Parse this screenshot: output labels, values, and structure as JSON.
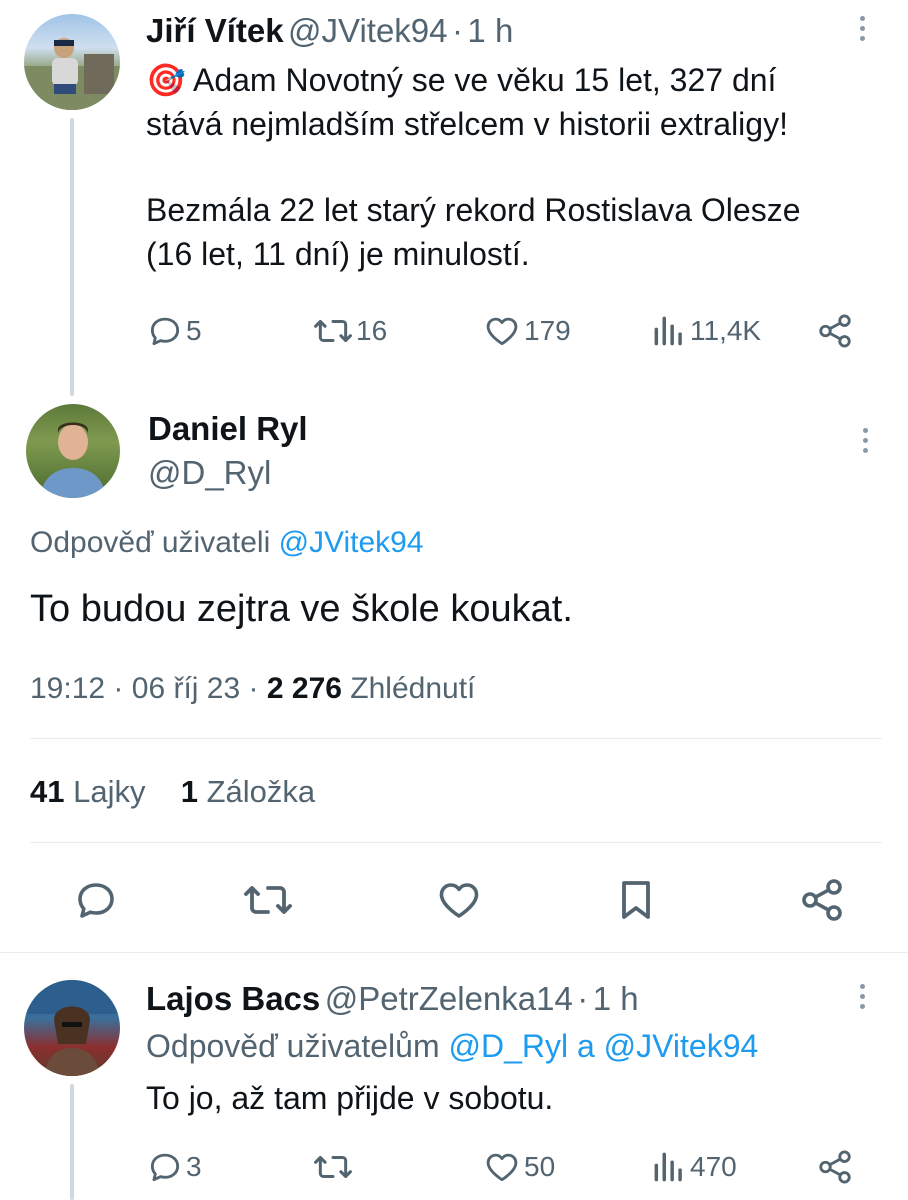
{
  "tweet1": {
    "name": "Jiří Vítek",
    "handle": "@JVitek94",
    "dot": "·",
    "time": "1 h",
    "emoji": "🎯",
    "line1": "Adam Novotný se ve věku 15 let, 327 dní",
    "line2": "stává nejmladším střelcem v historii extraligy!",
    "line3": "Bezmála 22 let starý rekord Rostislava Olesze",
    "line4": "(16 let, 11 dní) je minulostí.",
    "replies": "5",
    "reposts": "16",
    "likes": "179",
    "views": "11,4K"
  },
  "main": {
    "name": "Daniel Ryl",
    "handle": "@D_Ryl",
    "reply_prefix": "Odpověď uživateli",
    "reply_to": "@JVitek94",
    "text": "To budou zejtra ve škole koukat.",
    "time": "19:12",
    "sep1": "·",
    "date": "06 říj 23",
    "sep2": "·",
    "views_count": "2 276",
    "views_label": "Zhlédnutí",
    "likes_count": "41",
    "likes_label": "Lajky",
    "bookmarks_count": "1",
    "bookmarks_label": "Záložka"
  },
  "tweet3": {
    "name": "Lajos Bacs",
    "handle": "@PetrZelenka14",
    "dot": "·",
    "time": "1 h",
    "reply_prefix": "Odpověď uživatelům",
    "reply_to1": "@D_Ryl",
    "reply_and": "a",
    "reply_to2": "@JVitek94",
    "text": "To jo, až tam přijde v sobotu.",
    "replies": "3",
    "likes": "50",
    "views": "470"
  },
  "colors": {
    "text": "#0f1419",
    "secondary": "#536471",
    "link": "#1d9bf0",
    "divider": "#e6ecf0"
  },
  "icons": [
    "reply-icon",
    "repost-icon",
    "like-icon",
    "views-icon",
    "share-icon",
    "bookmark-icon",
    "more-icon",
    "target-emoji"
  ]
}
